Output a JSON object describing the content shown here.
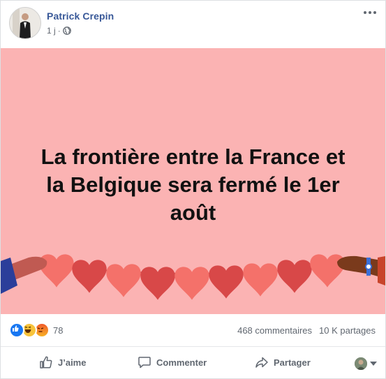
{
  "post": {
    "author": "Patrick Crepin",
    "time": "1 j",
    "separator": "·",
    "audience_icon": "globe-icon",
    "banner": {
      "text": "La frontière entre la France et\nla Belgique sera fermé le 1er\naoût",
      "background": "#fbb3b3"
    },
    "reactions": {
      "types": [
        "like-icon",
        "haha-icon",
        "angry-icon"
      ],
      "count": "78"
    },
    "comments_count": "468 commentaires",
    "shares_count": "10 K partages",
    "actions": {
      "like": "J’aime",
      "comment": "Commenter",
      "share": "Partager"
    }
  }
}
